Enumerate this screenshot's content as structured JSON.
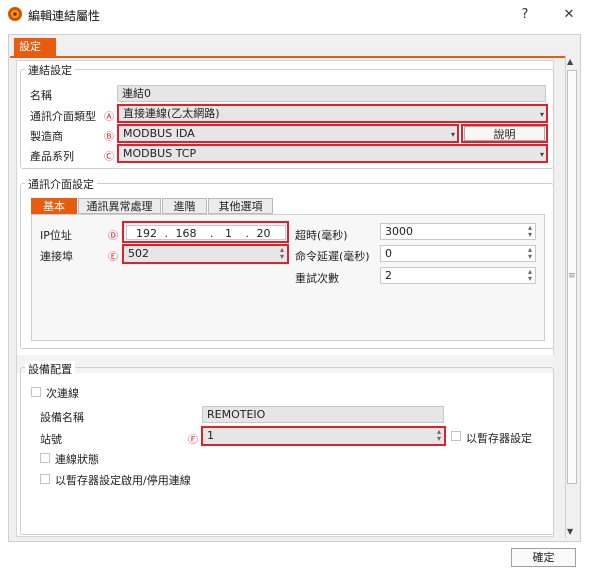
{
  "window": {
    "title": "編輯連結屬性",
    "help": "?",
    "close": "✕"
  },
  "top_tab": "設定",
  "connection": {
    "group_title": "連結設定",
    "name_label": "名稱",
    "name_value": "連結0",
    "iface_type_label": "通訊介面類型",
    "iface_type_marker": "Ⓐ",
    "iface_type_value": "直接連線(乙太網路)",
    "maker_label": "製造商",
    "maker_marker": "Ⓑ",
    "maker_value": "MODBUS IDA",
    "explain_button": "說明",
    "series_label": "產品系列",
    "series_marker": "Ⓒ",
    "series_value": "MODBUS TCP"
  },
  "comm": {
    "group_title": "通訊介面設定",
    "tabs": [
      "基本",
      "通訊異常處理",
      "進階",
      "其他選項"
    ],
    "ip_label": "IP位址",
    "ip_marker": "Ⓓ",
    "ip_parts": [
      "192",
      ".",
      "168",
      ".",
      "1",
      ".",
      "20"
    ],
    "port_label": "連接埠",
    "port_marker": "Ⓔ",
    "port_value": "502",
    "timeout_label": "超時(毫秒)",
    "timeout_value": "3000",
    "cmd_delay_label": "命令延遲(毫秒)",
    "cmd_delay_value": "0",
    "retry_label": "重試次數",
    "retry_value": "2"
  },
  "device": {
    "group_title": "設備配置",
    "secondary_label": "次連線",
    "device_name_label": "設備名稱",
    "device_name_value": "REMOTEIO",
    "station_label": "站號",
    "station_marker": "Ⓕ",
    "station_value": "1",
    "use_register_label": "以暫存器設定",
    "link_status_label": "連線狀態",
    "register_enable_label": "以暫存器設定啟用/停用連線"
  },
  "ok_button": "確定",
  "colors": {
    "accent": "#e85c10",
    "highlight": "#e0202a"
  }
}
